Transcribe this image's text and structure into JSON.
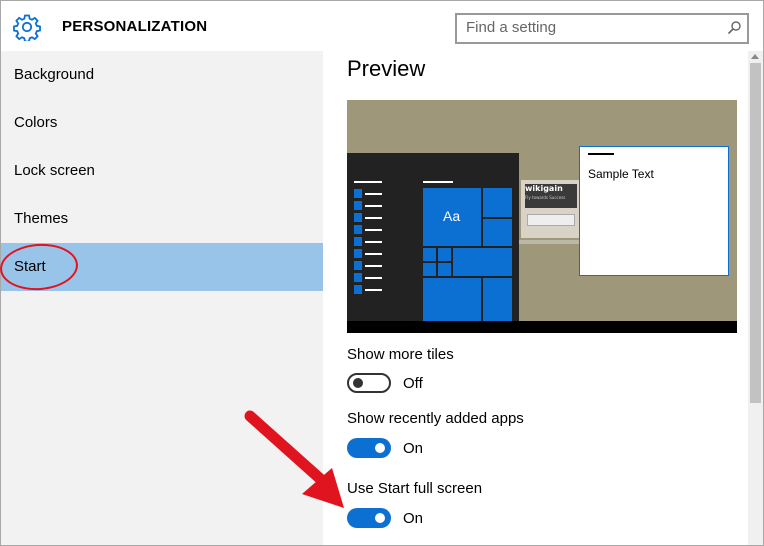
{
  "header": {
    "title": "PERSONALIZATION",
    "search_placeholder": "Find a setting",
    "gear_icon": "gear-icon",
    "search_icon": "search-icon"
  },
  "sidebar": {
    "items": [
      {
        "label": "Background",
        "active": false
      },
      {
        "label": "Colors",
        "active": false
      },
      {
        "label": "Lock screen",
        "active": false
      },
      {
        "label": "Themes",
        "active": false
      },
      {
        "label": "Start",
        "active": true
      }
    ]
  },
  "content": {
    "preview_title": "Preview",
    "preview": {
      "sample_text": "Sample Text",
      "tile_label": "Aa",
      "ad_brand": "wikigain",
      "ad_tagline": "Fly towards Success"
    },
    "settings": [
      {
        "label": "Show more tiles",
        "state": "Off",
        "on": false
      },
      {
        "label": "Show recently added apps",
        "state": "On",
        "on": true
      },
      {
        "label": "Use Start full screen",
        "state": "On",
        "on": true
      }
    ]
  },
  "colors": {
    "accent": "#0c6fd2",
    "active_nav": "#99c4ea",
    "annotation_red": "#e0141e",
    "sidebar_bg": "#f2f2f2",
    "preview_bg": "#9e977a"
  }
}
